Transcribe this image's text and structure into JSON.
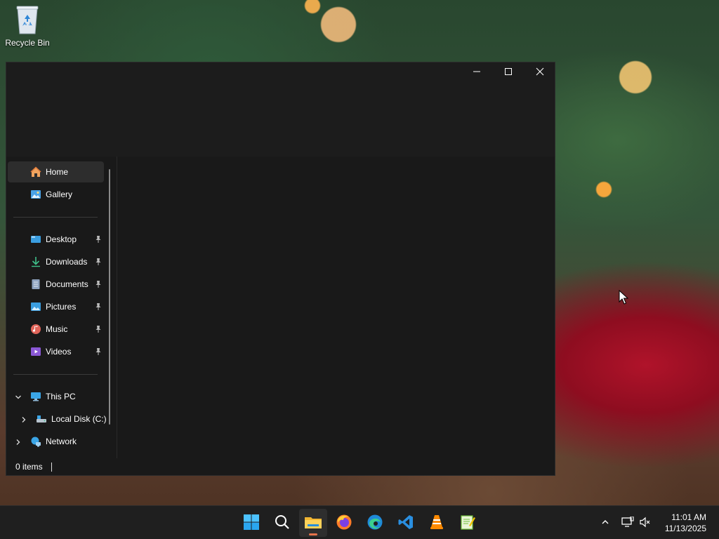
{
  "desktop": {
    "recycle_bin_label": "Recycle Bin"
  },
  "explorer": {
    "window_controls": {
      "minimize": "minimize-icon",
      "maximize": "maximize-icon",
      "close": "close-icon"
    },
    "nav": {
      "home": "Home",
      "gallery": "Gallery",
      "quick_access": [
        {
          "label": "Desktop",
          "icon": "desktop-folder-icon",
          "pinned": true
        },
        {
          "label": "Downloads",
          "icon": "downloads-folder-icon",
          "pinned": true
        },
        {
          "label": "Documents",
          "icon": "documents-folder-icon",
          "pinned": true
        },
        {
          "label": "Pictures",
          "icon": "pictures-folder-icon",
          "pinned": true
        },
        {
          "label": "Music",
          "icon": "music-folder-icon",
          "pinned": true
        },
        {
          "label": "Videos",
          "icon": "videos-folder-icon",
          "pinned": true
        }
      ],
      "this_pc": "This PC",
      "local_disk": "Local Disk (C:)",
      "network": "Network"
    },
    "status": {
      "item_count": "0 items"
    }
  },
  "taskbar": {
    "apps": [
      {
        "name": "start",
        "icon": "windows-start-icon"
      },
      {
        "name": "search",
        "icon": "search-icon"
      },
      {
        "name": "file-explorer",
        "icon": "file-explorer-icon",
        "active": true
      },
      {
        "name": "firefox",
        "icon": "firefox-icon"
      },
      {
        "name": "edge",
        "icon": "edge-icon"
      },
      {
        "name": "vscode",
        "icon": "vscode-icon"
      },
      {
        "name": "vlc",
        "icon": "vlc-icon"
      },
      {
        "name": "notepad-plus",
        "icon": "notepad-icon"
      }
    ],
    "clock": {
      "time": "11:01 AM",
      "date": "11/13/2025"
    }
  },
  "colors": {
    "accent": "#e6734b",
    "window_bg": "#191919",
    "taskbar_bg": "#1f1f1f"
  }
}
